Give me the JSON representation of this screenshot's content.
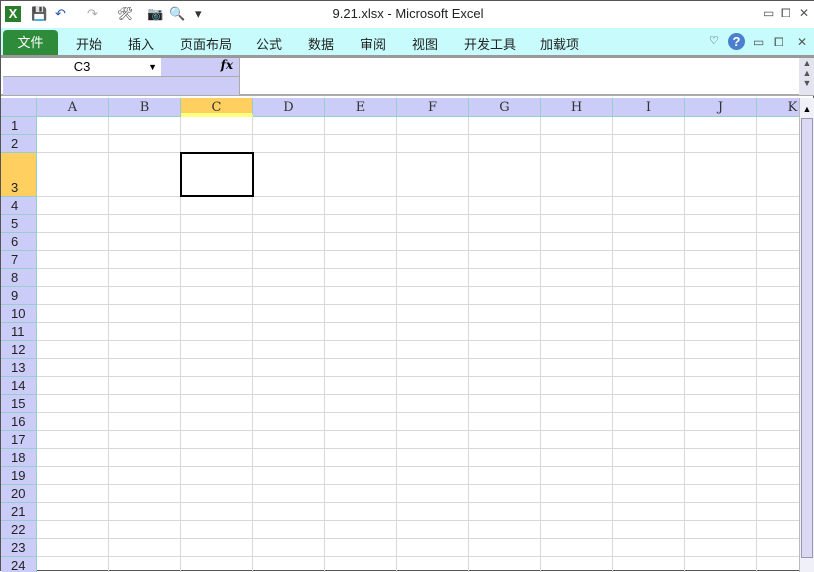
{
  "window": {
    "title": "9.21.xlsx  -  Microsoft Excel",
    "minimize": "▭",
    "restore": "⧠",
    "close": "✕"
  },
  "quick_access": {
    "undo": "↶",
    "redo": "↷",
    "more": "▾"
  },
  "ribbon": {
    "tabs": [
      "文件",
      "开始",
      "插入",
      "页面布局",
      "公式",
      "数据",
      "审阅",
      "视图",
      "开发工具",
      "加载项"
    ],
    "help": "?"
  },
  "formula_bar": {
    "name_box": "C3",
    "fx": "fx",
    "formula": ""
  },
  "sheet": {
    "columns": [
      "A",
      "B",
      "C",
      "D",
      "E",
      "F",
      "G",
      "H",
      "I",
      "J",
      "K"
    ],
    "rows": [
      "1",
      "2",
      "3",
      "4",
      "5",
      "6",
      "7",
      "8",
      "9",
      "10",
      "11",
      "12",
      "13",
      "14",
      "15",
      "16",
      "17",
      "18",
      "19",
      "20",
      "21",
      "22",
      "23",
      "24"
    ],
    "selected_cell": "C3"
  }
}
